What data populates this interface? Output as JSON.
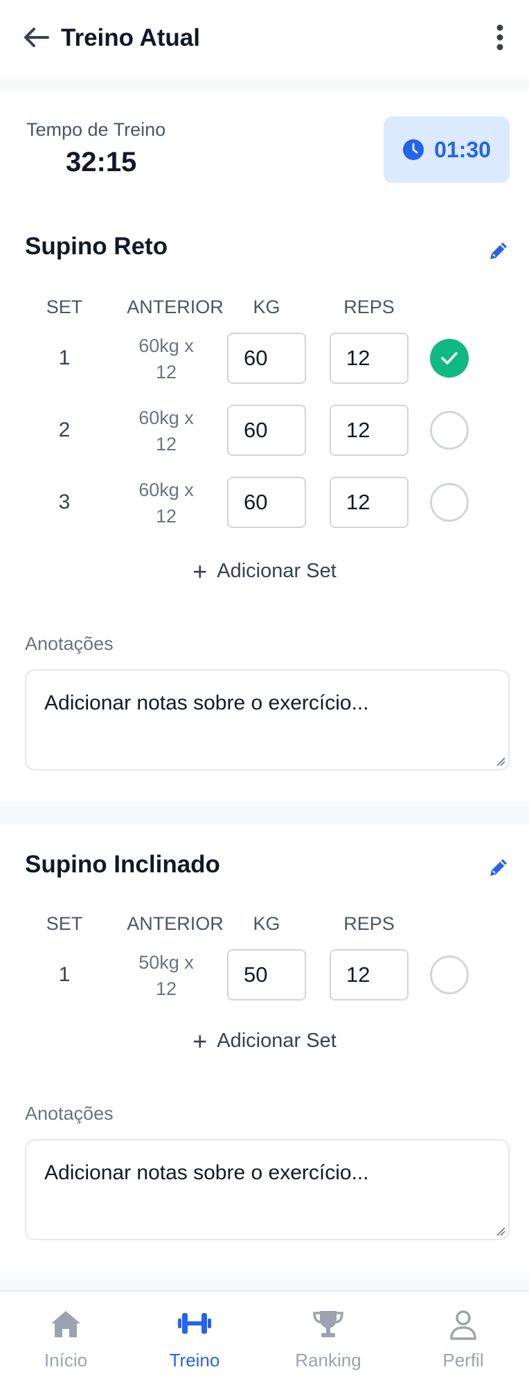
{
  "header": {
    "title": "Treino Atual",
    "back_icon": "arrow-left-icon",
    "menu_icon": "more-vertical-icon"
  },
  "timer": {
    "label": "Tempo de Treino",
    "value": "32:15",
    "rest": "01:30",
    "rest_icon": "clock-icon"
  },
  "columns": {
    "set": "SET",
    "previous": "ANTERIOR",
    "kg": "KG",
    "reps": "REPS"
  },
  "exercises": [
    {
      "name": "Supino Reto",
      "sets": [
        {
          "set": "1",
          "previous_line1": "60kg x",
          "previous_line2": "12",
          "kg": "60",
          "reps": "12",
          "completed": true
        },
        {
          "set": "2",
          "previous_line1": "60kg x",
          "previous_line2": "12",
          "kg": "60",
          "reps": "12",
          "completed": false
        },
        {
          "set": "3",
          "previous_line1": "60kg x",
          "previous_line2": "12",
          "kg": "60",
          "reps": "12",
          "completed": false
        }
      ],
      "add_set": "Adicionar Set",
      "notes_label": "Anotações",
      "notes_placeholder": "Adicionar notas sobre o exercício..."
    },
    {
      "name": "Supino Inclinado",
      "sets": [
        {
          "set": "1",
          "previous_line1": "50kg x",
          "previous_line2": "12",
          "kg": "50",
          "reps": "12",
          "completed": false
        }
      ],
      "add_set": "Adicionar Set",
      "notes_label": "Anotações",
      "notes_placeholder": "Adicionar notas sobre o exercício..."
    }
  ],
  "nav": [
    {
      "label": "Início",
      "icon": "home-icon",
      "active": false
    },
    {
      "label": "Treino",
      "icon": "dumbbell-icon",
      "active": true
    },
    {
      "label": "Ranking",
      "icon": "trophy-icon",
      "active": false
    },
    {
      "label": "Perfil",
      "icon": "user-icon",
      "active": false
    }
  ],
  "colors": {
    "accent": "#2563eb",
    "success": "#10b981",
    "badge_bg": "#dbeafe",
    "muted": "#9ca3af"
  }
}
